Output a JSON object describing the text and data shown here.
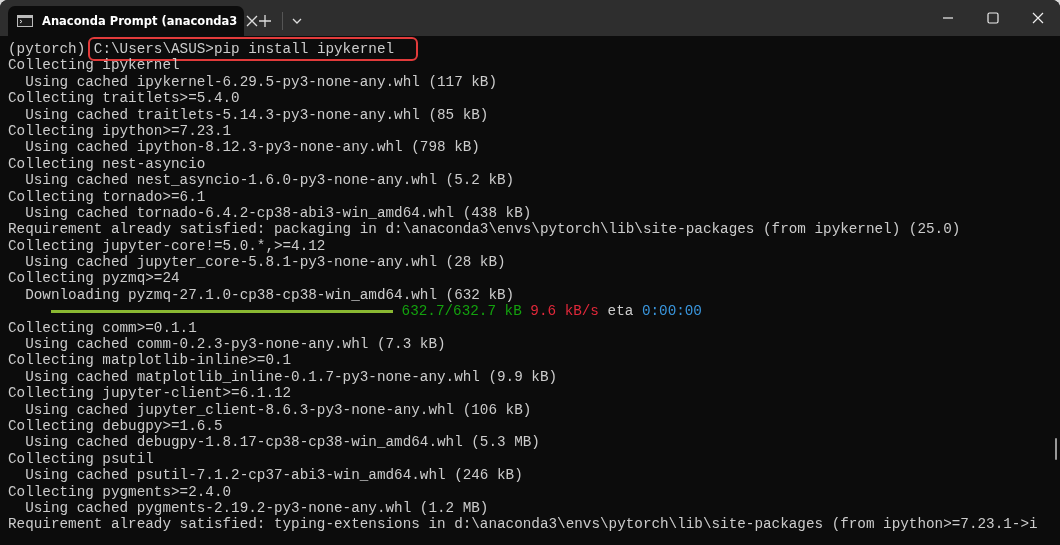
{
  "window": {
    "tab": {
      "title": "Anaconda Prompt (anaconda3",
      "selected": true
    }
  },
  "lines": [
    {
      "kind": "command",
      "prompt": "(pytorch)",
      "text": "C:\\Users\\ASUS>pip install ipykernel",
      "highlighted": true
    },
    {
      "kind": "text",
      "text": "Collecting ipykernel"
    },
    {
      "kind": "text",
      "text": "  Using cached ipykernel-6.29.5-py3-none-any.whl (117 kB)"
    },
    {
      "kind": "text",
      "text": "Collecting traitlets>=5.4.0"
    },
    {
      "kind": "text",
      "text": "  Using cached traitlets-5.14.3-py3-none-any.whl (85 kB)"
    },
    {
      "kind": "text",
      "text": "Collecting ipython>=7.23.1"
    },
    {
      "kind": "text",
      "text": "  Using cached ipython-8.12.3-py3-none-any.whl (798 kB)"
    },
    {
      "kind": "text",
      "text": "Collecting nest-asyncio"
    },
    {
      "kind": "text",
      "text": "  Using cached nest_asyncio-1.6.0-py3-none-any.whl (5.2 kB)"
    },
    {
      "kind": "text",
      "text": "Collecting tornado>=6.1"
    },
    {
      "kind": "text",
      "text": "  Using cached tornado-6.4.2-cp38-abi3-win_amd64.whl (438 kB)"
    },
    {
      "kind": "text",
      "text": "Requirement already satisfied: packaging in d:\\anaconda3\\envs\\pytorch\\lib\\site-packages (from ipykernel) (25.0)"
    },
    {
      "kind": "text",
      "text": "Collecting jupyter-core!=5.0.*,>=4.12"
    },
    {
      "kind": "text",
      "text": "  Using cached jupyter_core-5.8.1-py3-none-any.whl (28 kB)"
    },
    {
      "kind": "text",
      "text": "Collecting pyzmq>=24"
    },
    {
      "kind": "text",
      "text": "  Downloading pyzmq-27.1.0-cp38-cp38-win_amd64.whl (632 kB)"
    },
    {
      "kind": "progress",
      "level": 1,
      "amount": "632.7/632.7 kB",
      "speed": "9.6 kB/s",
      "eta_label": "eta",
      "eta": "0:00:00"
    },
    {
      "kind": "text",
      "text": "Collecting comm>=0.1.1"
    },
    {
      "kind": "text",
      "text": "  Using cached comm-0.2.3-py3-none-any.whl (7.3 kB)"
    },
    {
      "kind": "text",
      "text": "Collecting matplotlib-inline>=0.1"
    },
    {
      "kind": "text",
      "text": "  Using cached matplotlib_inline-0.1.7-py3-none-any.whl (9.9 kB)"
    },
    {
      "kind": "text",
      "text": "Collecting jupyter-client>=6.1.12"
    },
    {
      "kind": "text",
      "text": "  Using cached jupyter_client-8.6.3-py3-none-any.whl (106 kB)"
    },
    {
      "kind": "text",
      "text": "Collecting debugpy>=1.6.5"
    },
    {
      "kind": "text",
      "text": "  Using cached debugpy-1.8.17-cp38-cp38-win_amd64.whl (5.3 MB)"
    },
    {
      "kind": "text",
      "text": "Collecting psutil"
    },
    {
      "kind": "text",
      "text": "  Using cached psutil-7.1.2-cp37-abi3-win_amd64.whl (246 kB)"
    },
    {
      "kind": "text",
      "text": "Collecting pygments>=2.4.0"
    },
    {
      "kind": "text",
      "text": "  Using cached pygments-2.19.2-py3-none-any.whl (1.2 MB)"
    },
    {
      "kind": "text",
      "text": "Requirement already satisfied: typing-extensions in d:\\anaconda3\\envs\\pytorch\\lib\\site-packages (from ipython>=7.23.1->i"
    }
  ]
}
